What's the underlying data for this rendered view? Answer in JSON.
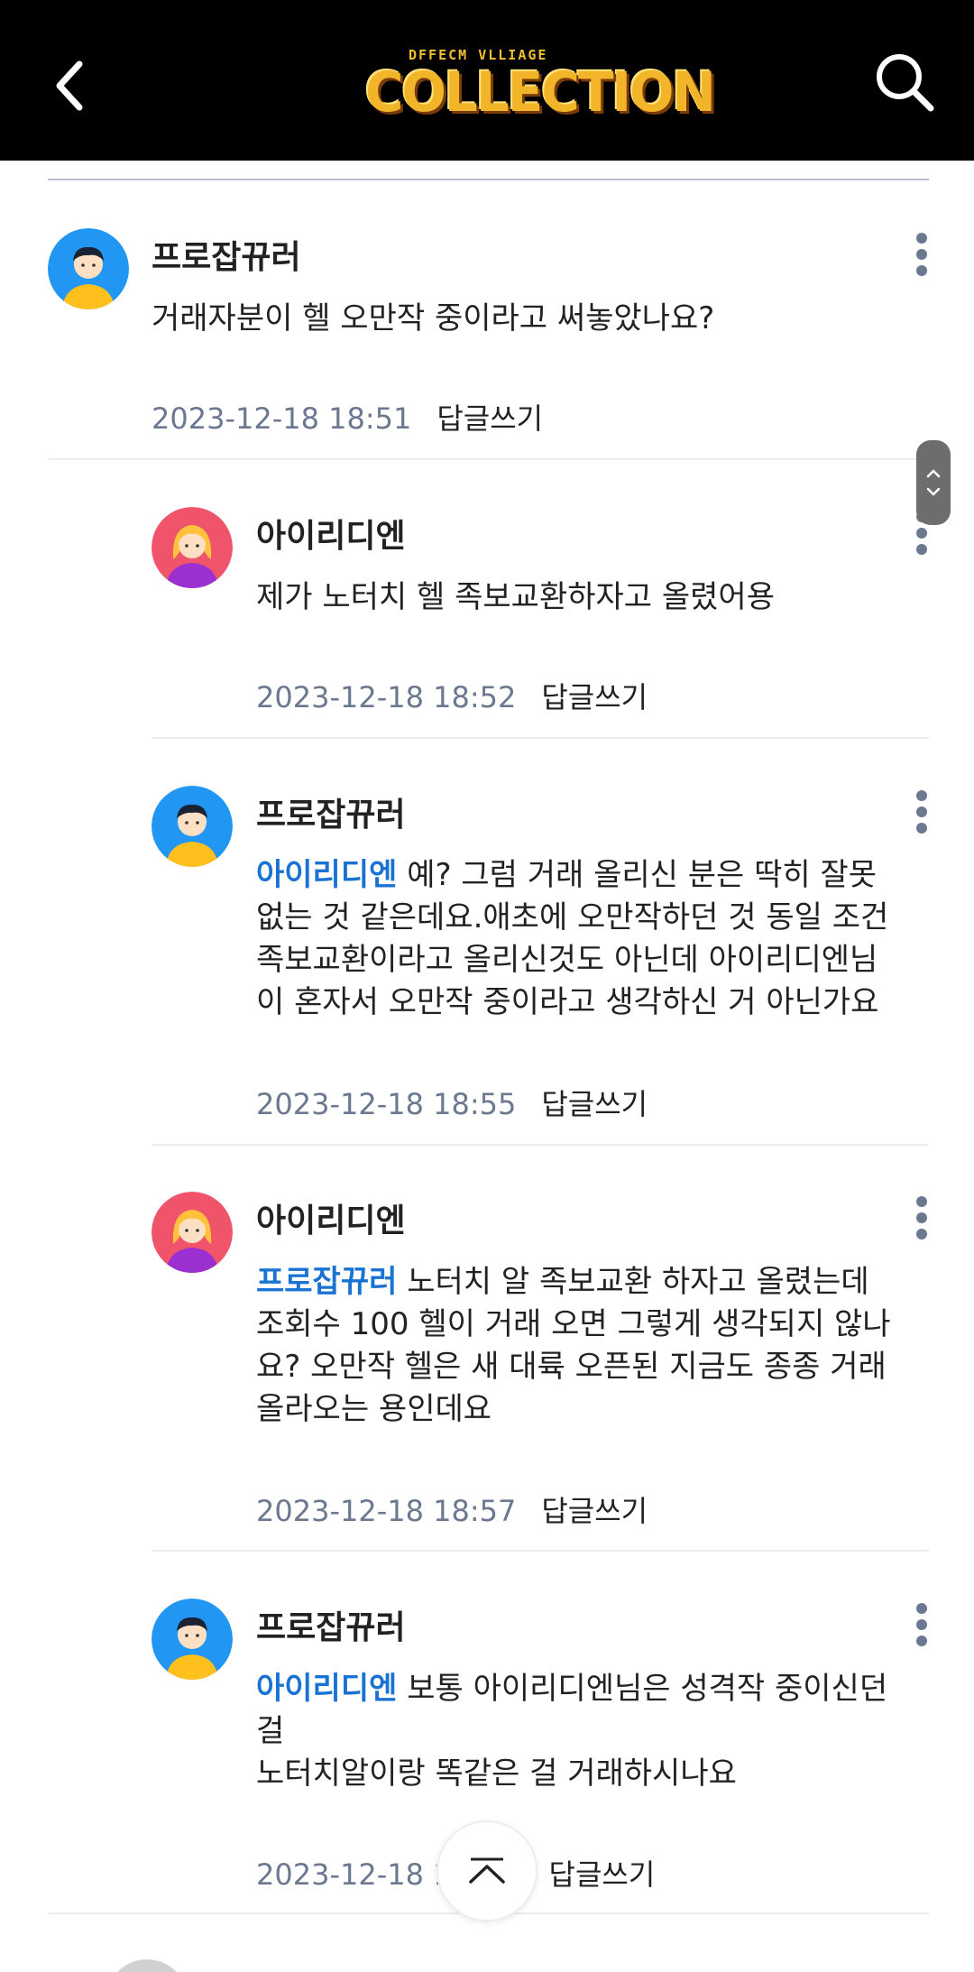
{
  "header": {
    "logo_top": "DFFECM VLLIAGE",
    "logo_main": "COLLECTION"
  },
  "comments": [
    {
      "nickname": "프로잡뀨러",
      "avatar": "male-avatar",
      "mention": "",
      "lines": [
        "거래자분이 헬 오만작 중이라고 써놓았나요?"
      ],
      "date": "2023-12-18 18:51",
      "reply_label": "답글쓰기"
    },
    {
      "nickname": "아이리디엔",
      "avatar": "female-avatar",
      "mention": "",
      "lines": [
        "제가 노터치 헬 족보교환하자고 올렸어용"
      ],
      "date": "2023-12-18 18:52",
      "reply_label": "답글쓰기"
    },
    {
      "nickname": "프로잡뀨러",
      "avatar": "male-avatar",
      "mention": "아이리디엔",
      "lines": [
        " 예? 그럼 거래 올리신 분은 딱히 잘못",
        "없는 것 같은데요.애초에 오만작하던 것 동일 조건",
        "족보교환이라고 올리신것도 아닌데 아이리디엔님",
        "이 혼자서 오만작 중이라고 생각하신 거 아닌가요"
      ],
      "date": "2023-12-18 18:55",
      "reply_label": "답글쓰기"
    },
    {
      "nickname": "아이리디엔",
      "avatar": "female-avatar",
      "mention": "프로잡뀨러",
      "lines": [
        " 노터치 알 족보교환 하자고 올렸는데",
        "조회수 100 헬이 거래 오면 그렇게 생각되지 않나",
        "요? 오만작 헬은 새 대륙 오픈된 지금도 종종 거래",
        "올라오는 용인데요"
      ],
      "date": "2023-12-18 18:57",
      "reply_label": "답글쓰기"
    },
    {
      "nickname": "프로잡뀨러",
      "avatar": "male-avatar",
      "mention": "아이리디엔",
      "lines": [
        " 보통 아이리디엔님은 성격작 중이신던",
        "걸",
        "노터치알이랑 똑같은 걸 거래하시나요"
      ],
      "date": "2023-12-18 1",
      "reply_label": "답글쓰기"
    }
  ],
  "colors": {
    "header_bg": "#000000",
    "mention": "#1a73d2",
    "date": "#6b7890",
    "logo": "#f2b52a"
  }
}
